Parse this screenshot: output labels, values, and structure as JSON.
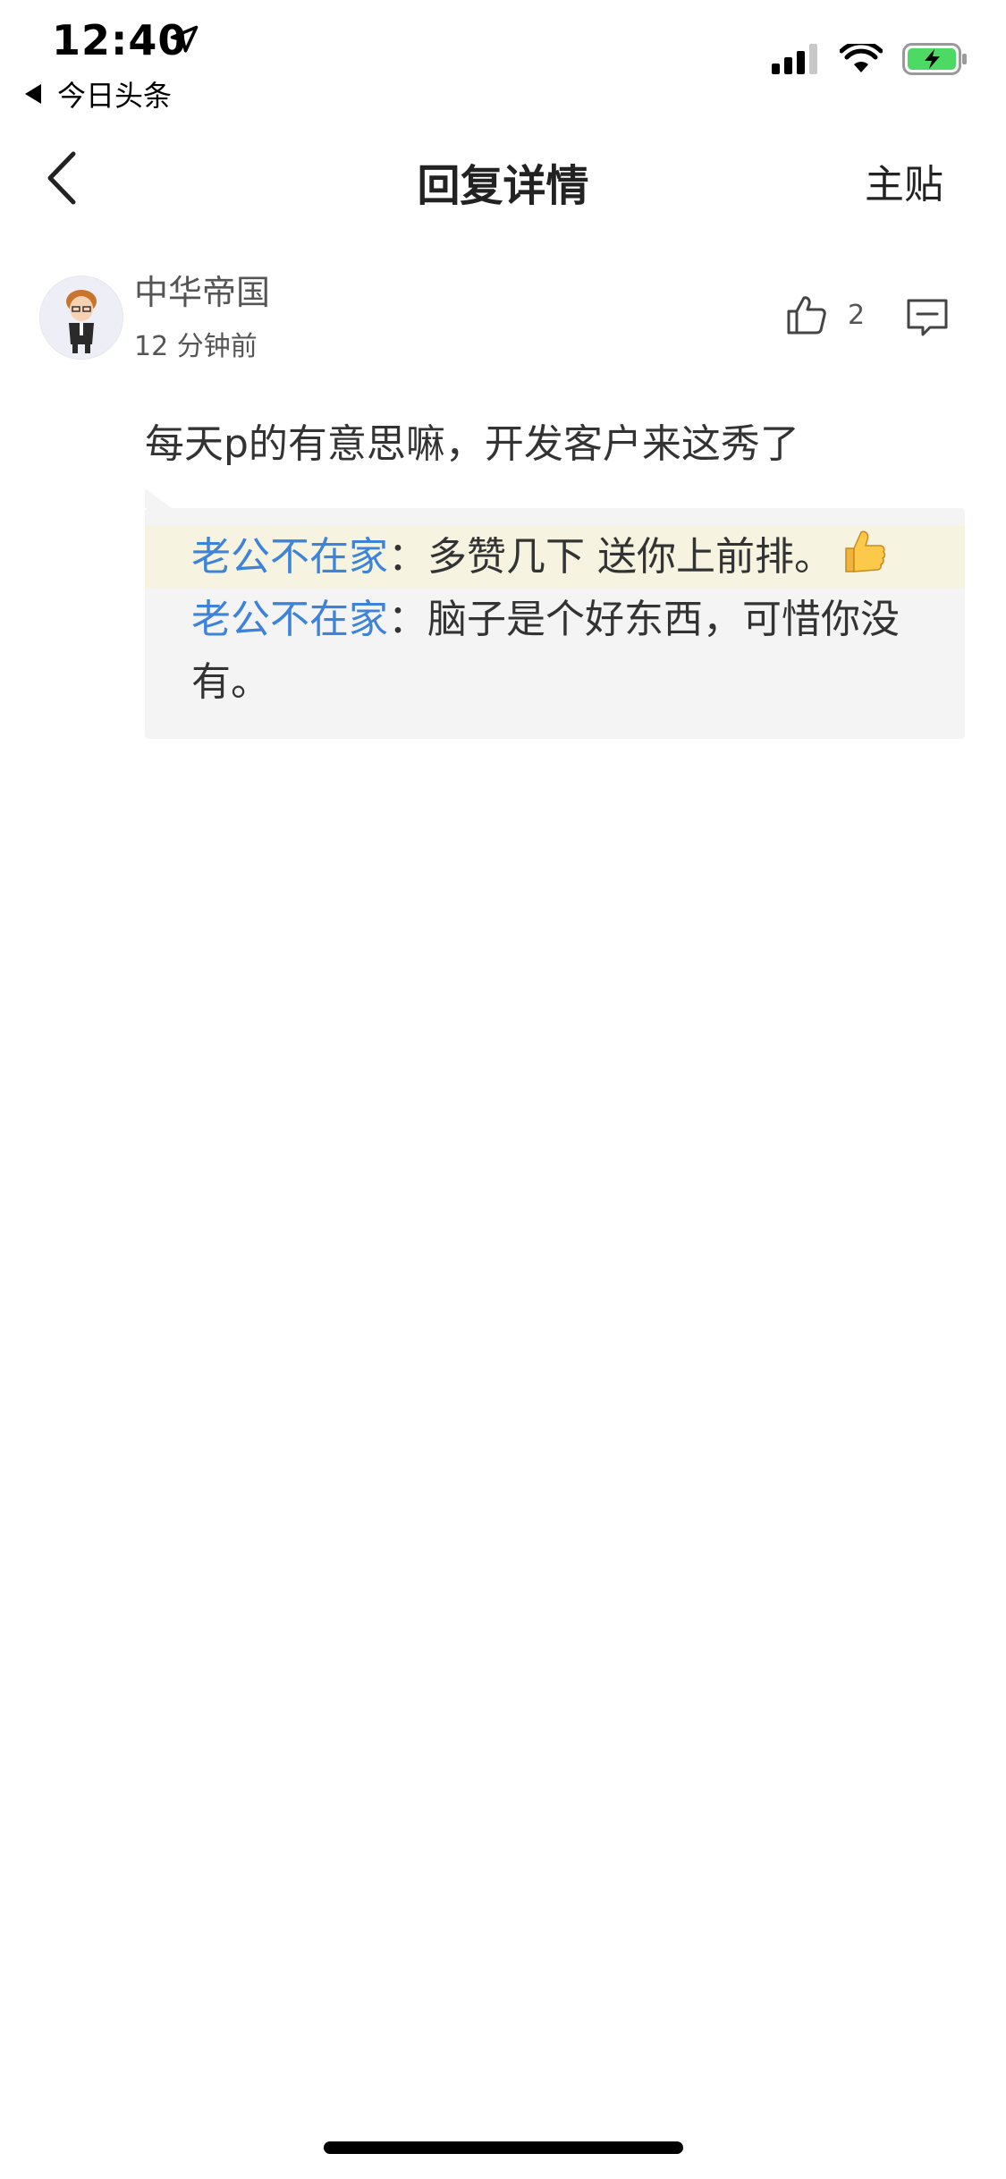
{
  "status_bar": {
    "time": "12:40",
    "back_app_label": "今日头条",
    "icons": [
      "location-arrow-icon",
      "cellular-signal-icon",
      "wifi-icon",
      "battery-charging-icon"
    ]
  },
  "nav": {
    "title": "回复详情",
    "main_post_label": "主贴",
    "back_icon": "chevron-left-icon"
  },
  "comment": {
    "username": "中华帝国",
    "timestamp": "12 分钟前",
    "like_count": "2",
    "text": "每天p的有意思嘛，开发客户来这秀了"
  },
  "replies": [
    {
      "author": "老公不在家",
      "separator": "：",
      "text": "多赞几下 送你上前排。",
      "emoji": "thumbs-up-icon",
      "highlighted": true
    },
    {
      "author": "老公不在家",
      "separator": "：",
      "text": "脑子是个好东西，可惜你没有。",
      "highlighted": false
    }
  ],
  "colors": {
    "link_blue": "#3d83d9",
    "reply_box_bg": "#f4f4f4",
    "highlight_bg": "#f6f3e1",
    "battery_green": "#4cd964"
  }
}
